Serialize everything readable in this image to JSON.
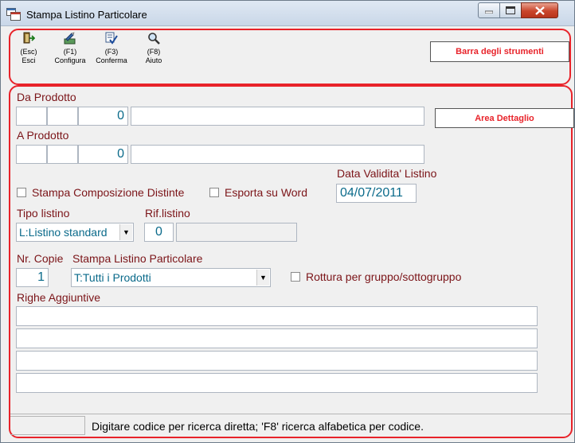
{
  "window": {
    "title": "Stampa Listino Particolare"
  },
  "toolbar": {
    "items": [
      {
        "key": "(Esc)",
        "label": "Esci",
        "icon": "exit-door-icon"
      },
      {
        "key": "(F1)",
        "label": "Configura",
        "icon": "configure-icon"
      },
      {
        "key": "(F3)",
        "label": "Conferma",
        "icon": "confirm-icon"
      },
      {
        "key": "(F8)",
        "label": "Aiuto",
        "icon": "magnifier-icon"
      }
    ]
  },
  "callouts": {
    "toolbar": "Barra degli strumenti",
    "detail": "Area Dettaglio"
  },
  "form": {
    "da_prodotto": {
      "label": "Da Prodotto",
      "seg1": "",
      "seg2": "",
      "number": "0",
      "desc": ""
    },
    "a_prodotto": {
      "label": "A Prodotto",
      "seg1": "",
      "seg2": "",
      "number": "0",
      "desc": ""
    },
    "data_validita": {
      "label": "Data Validita' Listino",
      "value": "04/07/2011"
    },
    "stampa_composizione": {
      "label": "Stampa Composizione Distinte",
      "checked": false
    },
    "esporta_word": {
      "label": "Esporta su Word",
      "checked": false
    },
    "tipo_listino": {
      "label": "Tipo listino",
      "value": "L:Listino standard"
    },
    "rif_listino": {
      "label": "Rif.listino",
      "number": "0",
      "desc": ""
    },
    "nr_copie": {
      "label": "Nr. Copie",
      "value": "1"
    },
    "stampa_listino": {
      "label": "Stampa Listino Particolare",
      "value": "T:Tutti i Prodotti"
    },
    "rottura": {
      "label": "Rottura per gruppo/sottogruppo",
      "checked": false
    },
    "righe_aggiuntive": {
      "label": "Righe Aggiuntive",
      "lines": [
        "",
        "",
        "",
        ""
      ]
    }
  },
  "status": {
    "text": "Digitare codice per ricerca diretta; 'F8' ricerca alfabetica per codice."
  },
  "colors": {
    "label": "#7b1418",
    "value": "#0a6a8a",
    "annotation": "#e8232a"
  }
}
